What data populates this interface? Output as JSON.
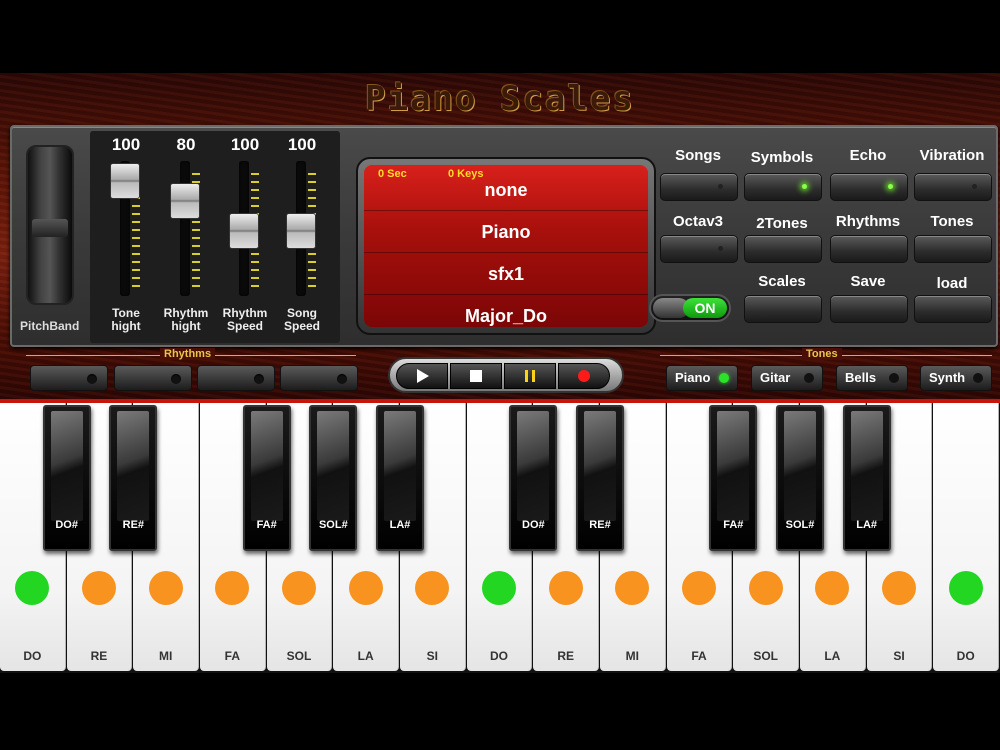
{
  "app": {
    "title": "Piano Scales"
  },
  "pitch": {
    "label": "PitchBand"
  },
  "sliders": [
    {
      "value": "100",
      "label_line1": "Tone",
      "label_line2": "hight",
      "level": 1.0
    },
    {
      "value": "80",
      "label_line1": "Rhythm",
      "label_line2": "hight",
      "level": 0.8
    },
    {
      "value": "100",
      "label_line1": "Rhythm",
      "label_line2": "Speed",
      "level": 0.5
    },
    {
      "value": "100",
      "label_line1": "Song",
      "label_line2": "Speed",
      "level": 0.5
    }
  ],
  "display": {
    "seconds": "0 Sec",
    "keys": "0 Keys",
    "rows": [
      "none",
      "Piano",
      "sfx1",
      "Major_Do"
    ]
  },
  "controls": {
    "row1": [
      "Songs",
      "Symbols",
      "Echo",
      "Vibration"
    ],
    "row2": [
      "Octav3",
      "2Tones",
      "Rhythms",
      "Tones"
    ],
    "row3": [
      "Scales",
      "Save",
      "load"
    ],
    "toggle_label": "ON"
  },
  "rhythms": {
    "title": "Rhythms"
  },
  "tones": {
    "title": "Tones",
    "buttons": [
      "Piano",
      "Gitar",
      "Bells",
      "Synth"
    ]
  },
  "keys": {
    "white": [
      "DO",
      "RE",
      "MI",
      "FA",
      "SOL",
      "LA",
      "SI",
      "DO",
      "RE",
      "MI",
      "FA",
      "SOL",
      "LA",
      "SI",
      "DO"
    ],
    "black": [
      "DO#",
      "RE#",
      "FA#",
      "SOL#",
      "LA#",
      "DO#",
      "RE#",
      "FA#",
      "SOL#",
      "LA#"
    ]
  },
  "colors": {
    "root_note": "#22d622",
    "scale_note": "#f7931e",
    "display_red": "#b0120e",
    "accent_gold": "#e9c64a"
  }
}
